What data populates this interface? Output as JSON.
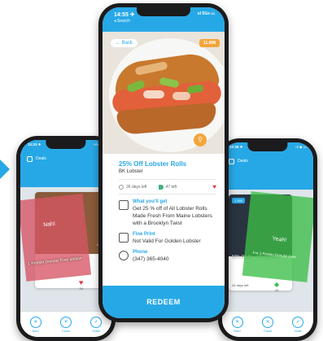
{
  "colors": {
    "accent": "#27a8e6",
    "orange": "#f2a53a",
    "nah": "#d65464",
    "yes": "#3cbe46",
    "heart": "#e0393e"
  },
  "main_phone": {
    "status": {
      "time": "14:55 ✈",
      "search": "◂ Search",
      "right": "ııl 5Gx ▭"
    },
    "back_label": "← Back",
    "distance_badge": "11.8MI",
    "deal": {
      "title": "25% Off Lobster Rolls",
      "store": "BK Lobster",
      "days_left": "26 days left",
      "claimed": "47 left",
      "what_title": "What you'll get",
      "what_text": "Get 25 % off of All Lobster Rolls Made Fresh From Maine Lobsters with a Brooklyn Twist",
      "fine_title": "Fine Print",
      "fine_text": "Not Valid For Golden Lobster",
      "phone_title": "Phone",
      "phone_text": "(347) 365-4040"
    },
    "redeem_label": "REDEEM",
    "icons": {
      "clock": "clock-icon",
      "tag": "tag-icon",
      "heart": "heart-icon"
    }
  },
  "left_phone": {
    "status": {
      "time": "12:23 ✈",
      "right": "ııl ◆ ▭"
    },
    "header_title": "Deals",
    "swipe_label": "Nah!",
    "caption": "1 Protein Donuts! Free utrition",
    "side_caption": "othie",
    "count": "24",
    "buttons": [
      {
        "label": "Nah!"
      },
      {
        "label": "Close"
      },
      {
        "label": "Yeah!"
      }
    ]
  },
  "right_phone": {
    "status": {
      "time": "12:26 ✈",
      "right": "ııl ◆ ▭"
    },
    "header_title": "Deals",
    "tag": "1.1MI",
    "swipe_label": "Yeah!",
    "caption": "50% Off An... lnfit Nutrition",
    "overlay_caption": "For 1 Protein Donuts! Free",
    "days": "24 days left",
    "count": "24",
    "buttons": [
      {
        "label": "Nah!"
      },
      {
        "label": "Close"
      },
      {
        "label": "Yeah!"
      }
    ]
  }
}
